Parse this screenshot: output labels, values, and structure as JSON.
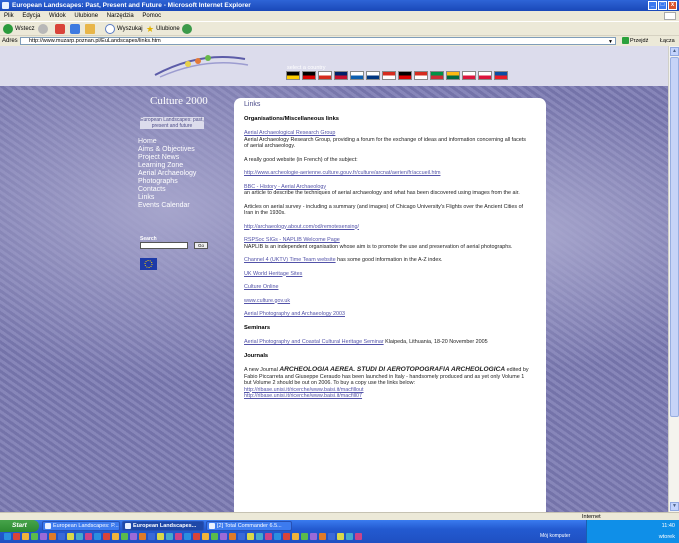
{
  "window": {
    "title": "European Landscapes: Past, Present and Future - Microsoft Internet Explorer",
    "min": "_",
    "max": "□",
    "close": "x"
  },
  "menu": [
    "Plik",
    "Edycja",
    "Widok",
    "Ulubione",
    "Narzędzia",
    "Pomoc"
  ],
  "toolbar": {
    "back": "Wstecz",
    "search": "Wyszukaj",
    "favorites": "Ulubione"
  },
  "address": {
    "label": "Adres",
    "url": "http://www.muzarp.poznan.pl/EuLandscapes/links.htm",
    "go": "Przejdź",
    "links": "Łącza"
  },
  "site": {
    "brand": "Culture 2000",
    "subtitle": "European Landscapes: past, present and future",
    "select_country": "select a country",
    "flags": [
      [
        "#000000",
        "#ffce00"
      ],
      [
        "#000000",
        "#dd0000"
      ],
      [
        "#ffffff",
        "#d52b1e"
      ],
      [
        "#012169",
        "#c8102e"
      ],
      [
        "#ffffff",
        "#0d5eaf"
      ],
      [
        "#ffffff",
        "#003580"
      ],
      [
        "#d52b1e",
        "#ffffff"
      ],
      [
        "#000000",
        "#dd0000"
      ],
      [
        "#d52b1e",
        "#ffffff"
      ],
      [
        "#009246",
        "#ce2b37"
      ],
      [
        "#fdb913",
        "#006a44"
      ],
      [
        "#ffffff",
        "#dc143c"
      ],
      [
        "#ffffff",
        "#dc143c"
      ],
      [
        "#0b4ea2",
        "#ee1c25"
      ]
    ],
    "nav": [
      "Home",
      "Aims & Objectives",
      "Project News",
      "Learning Zone",
      "Aerial Archaeology",
      "Photographs",
      "Contacts",
      "Links",
      "Events Calendar"
    ],
    "search_label": "Search",
    "search_go": "Go"
  },
  "content": {
    "heading": "Links",
    "sec1": "Organisations/Miscellaneous links",
    "aarg_link": "Aerial Archaeological Research Group",
    "aarg_desc": "Aerial Archaeology Research Group, providing a forum for the exchange of ideas and information concerning all facets of aerial archaeology.",
    "french_intro": "A really good website (in French) of the subject:",
    "french_link": "http://www.archeologie-aerienne.culture.gouv.fr/culture/arcnat/aerien/fr/accueil.htm",
    "bbc_link": "BBC - History - Aerial Archaeology",
    "bbc_desc": "an article to describe the techniques of aerial archaeology and what has been discovered using images from the air.",
    "survey_desc": "Articles on aerial survey - including a summary (and images) of Chicago University's Flights over the Ancient Cities of Iran in the 1930s.",
    "about_link": "http://archaeology.about.com/od/remotesensing/",
    "rspsoc_link": "RSPSoc SIGs - NAPLIB Welcome Page",
    "naplib_desc": "NAPLIB is an independent organisation whose aim is to promote the use and preservation of aerial photographs.",
    "ch4_link": "Channel 4 (UKTV) Time Team website",
    "ch4_rest": " has some good information in the A-Z index.",
    "unesco_link": "UK World Heritage Sites",
    "culture_link": "Culture Online",
    "gov_link": "www.culture.gov.uk",
    "photo2003_link": "Aerial Photography and Archaeology 2003",
    "sec2": "Seminars",
    "seminar_link": "Aerial Photography and Coastal Cultural Heritage Seminar",
    "seminar_rest": " Klaipeda, Lithuania, 18-20 November 2005",
    "sec3": "Journals",
    "journal_pre": "A new Journal ",
    "journal_title": "ARCHEOLOGIA AEREA. STUDI DI AEROTOPOGRAFIA ARCHEOLOGICA",
    "journal_rest": " edited by Fabio Piccarreta and Giuseppe Ceraudo has been launched in Italy - handsomely produced and as yet only Volume 1 but Volume 2 should be out on 2006. To buy a copy use the links below:",
    "journal_link1": "http://ribase.unisi.it/ricerche/www.baisi.it/macfillout",
    "journal_link2": "http://ribase.unisi.it/ricerche/www.baisi.it/macfill07"
  },
  "status": {
    "zone": "Internet"
  },
  "taskbar": {
    "start": "Start",
    "tasks": [
      "European Landscapes: P...",
      "European Landscapes...",
      "[2] Total Commander 6.5..."
    ],
    "my_computer": "Mój komputer",
    "clock": "11:40",
    "day": "wtorek"
  }
}
